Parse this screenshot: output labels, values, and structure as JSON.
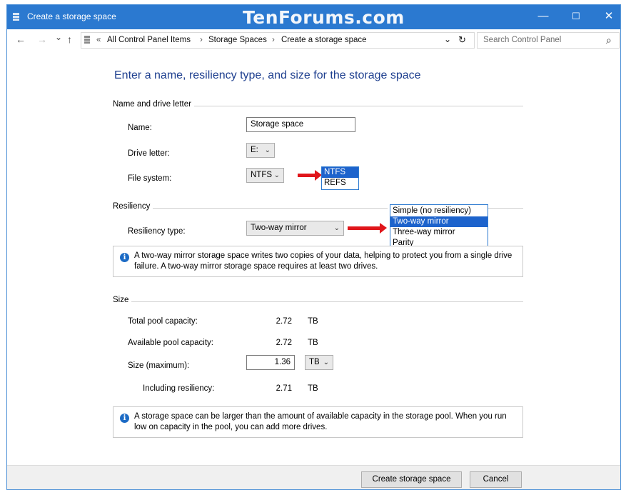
{
  "window": {
    "title": "Create a storage space",
    "watermark": "TenForums.com",
    "controls": {
      "minimize": "—",
      "maximize": "☐",
      "close": "✕"
    }
  },
  "addressbar": {
    "back": "←",
    "forward": "→",
    "recent": "⌄",
    "up": "↑",
    "overflow": "«",
    "crumbs": [
      "All Control Panel Items",
      "Storage Spaces",
      "Create a storage space"
    ],
    "separator": "›",
    "dropdown": "⌄",
    "refresh": "↻",
    "search_placeholder": "Search Control Panel",
    "search_icon": "⌕"
  },
  "heading": "Enter a name, resiliency type, and size for the storage space",
  "name_section": {
    "title": "Name and drive letter",
    "name_label": "Name:",
    "name_value": "Storage space",
    "drive_label": "Drive letter:",
    "drive_value": "E:",
    "fs_label": "File system:",
    "fs_value": "NTFS",
    "fs_options": [
      "NTFS",
      "REFS"
    ]
  },
  "resiliency": {
    "title": "Resiliency",
    "type_label": "Resiliency type:",
    "type_value": "Two-way mirror",
    "options": [
      "Simple (no resiliency)",
      "Two-way mirror",
      "Three-way mirror",
      "Parity"
    ],
    "selected_index": 1,
    "info": "A two-way mirror storage space writes two copies of your data, helping to protect you from a single drive failure. A two-way mirror storage space requires at least two drives."
  },
  "size": {
    "title": "Size",
    "total_label": "Total pool capacity:",
    "total_value": "2.72",
    "total_unit": "TB",
    "available_label": "Available pool capacity:",
    "available_value": "2.72",
    "available_unit": "TB",
    "size_label": "Size (maximum):",
    "size_value": "1.36",
    "size_unit": "TB",
    "including_label": "Including resiliency:",
    "including_value": "2.71",
    "including_unit": "TB",
    "info": "A storage space can be larger than the amount of available capacity in the storage pool. When you run low on capacity in the pool, you can add more drives."
  },
  "buttons": {
    "create": "Create storage space",
    "cancel": "Cancel"
  },
  "colors": {
    "accent": "#2b79d0",
    "heading": "#1e3f8f",
    "selection": "#1d63cc",
    "arrow": "#e0161b"
  }
}
